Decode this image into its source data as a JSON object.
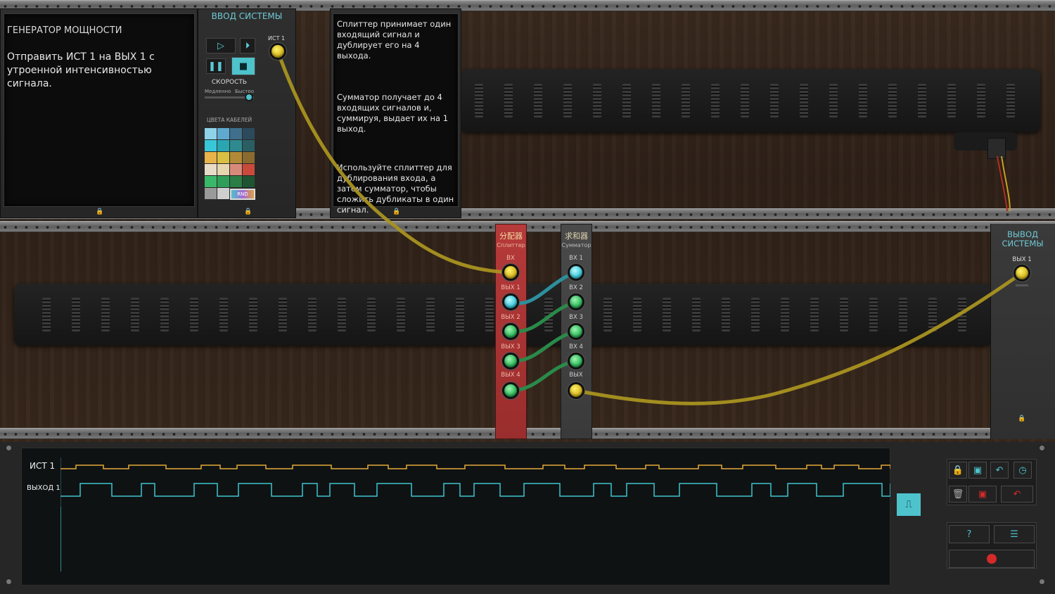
{
  "generator": {
    "title": "ГЕНЕРАТОР МОЩНОСТИ",
    "task": "Отправить ИСТ 1 на ВЫХ 1 с утроенной интенсивностью сигнала."
  },
  "system_input": {
    "title": "ВВОД СИСТЕМЫ",
    "speed_label": "СКОРОСТЬ",
    "speed_min_label": "Медленно",
    "speed_max_label": "Быстро",
    "speed_value": 0.9,
    "cable_colors_label": "ЦВЕТА КАБЕЛЕЙ",
    "rnd_label": "RND",
    "source_label": "ИСТ 1",
    "palette": [
      "#8fd3e8",
      "#5fa9d0",
      "#3f6f8c",
      "#2c4a5c",
      "#37c7d8",
      "#2aa6b2",
      "#2f8a8f",
      "#2b5e62",
      "#e8b34a",
      "#d9c042",
      "#b08a38",
      "#8a6a2e",
      "#e8dcc8",
      "#e6d6b0",
      "#d88a7a",
      "#c94a3a",
      "#3ab86a",
      "#2f9e58",
      "#2a7d45",
      "#1f5432",
      "#9a9a9a",
      "#cfcfcf"
    ]
  },
  "help": {
    "p1": "Сплиттер принимает один входящий сигнал и дублирует его на 4 выхода.",
    "p2": "Сумматор получает до 4 входящих сигналов и, суммируя, выдает их на 1 выход.",
    "p3": "Используйте сплиттер для дублирования входа, а затем сумматор, чтобы сложить дубликаты в один сигнал."
  },
  "splitter": {
    "title_cn": "分配器",
    "title": "Сплиттер",
    "in_label": "ВХ",
    "outs": [
      "ВЫХ 1",
      "ВЫХ 2",
      "ВЫХ 3",
      "ВЫХ 4"
    ]
  },
  "adder": {
    "title_cn": "求和器",
    "title": "Сумматор",
    "ins": [
      "ВХ 1",
      "ВХ 2",
      "ВХ 3",
      "ВХ 4"
    ],
    "out_label": "ВЫХ"
  },
  "system_output": {
    "title": "ВЫВОД СИСТЕМЫ",
    "out_label": "ВЫХ 1"
  },
  "scope": {
    "trace1_label": "ИСТ 1",
    "trace2_label": "ВЫХОД 1"
  },
  "colors": {
    "yellow_cable": "#c9b02a",
    "cyan_cable": "#2d8f9c",
    "green_cable": "#2a8a4a",
    "trace_in": "#e3a93a",
    "trace_out": "#3fc4cf",
    "record": "#d42a2a"
  },
  "icons": {
    "lock": "lock-icon",
    "save": "save-icon",
    "undo": "undo-icon",
    "timer": "timer-icon",
    "trash": "trash-icon",
    "delete": "delete-icon",
    "redo": "redo-icon",
    "help": "help-icon",
    "menu": "menu-icon",
    "record": "record-icon",
    "wave": "wave-icon"
  }
}
